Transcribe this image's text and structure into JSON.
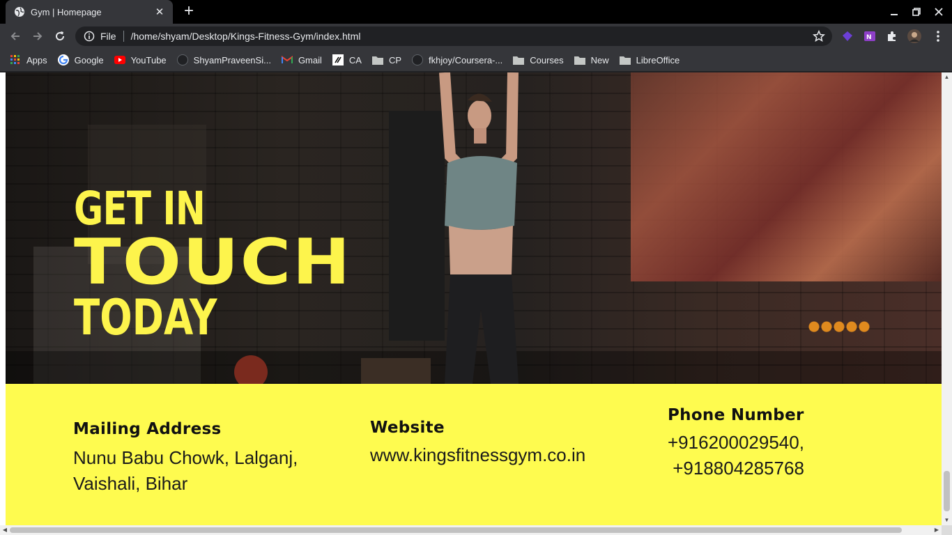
{
  "browser": {
    "tab": {
      "title": "Gym | Homepage",
      "close_glyph": "✕",
      "icon": "globe-icon"
    },
    "new_tab_glyph": "+",
    "window_controls": {
      "minimize": "—",
      "maximize": "❐",
      "close": "✕"
    },
    "address_bar": {
      "scheme_label": "File",
      "url": "/home/shyam/Desktop/Kings-Fitness-Gym/index.html"
    },
    "bookmarks": [
      {
        "label": "Apps",
        "icon": "apps-grid-icon"
      },
      {
        "label": "Google",
        "icon": "google-icon"
      },
      {
        "label": "YouTube",
        "icon": "youtube-icon"
      },
      {
        "label": "ShyamPraveenSi...",
        "icon": "github-icon"
      },
      {
        "label": "Gmail",
        "icon": "gmail-icon"
      },
      {
        "label": "CA",
        "icon": "ca-icon"
      },
      {
        "label": "CP",
        "icon": "folder-icon"
      },
      {
        "label": "fkhjoy/Coursera-...",
        "icon": "github-icon"
      },
      {
        "label": "Courses",
        "icon": "folder-icon"
      },
      {
        "label": "New",
        "icon": "folder-icon"
      },
      {
        "label": "LibreOffice",
        "icon": "folder-icon"
      }
    ],
    "colors": {
      "chrome_dark": "#35363a",
      "tab_strip": "#000000",
      "omnibox": "#202124"
    }
  },
  "page": {
    "hero": {
      "line1": "GET IN",
      "line2": "TOUCH",
      "line3": "TODAY"
    },
    "contact": {
      "mailing": {
        "heading": "Mailing Address",
        "line1": "Nunu Babu Chowk, Lalganj,",
        "line2": "Vaishali, Bihar"
      },
      "website": {
        "heading": "Website",
        "value": "www.kingsfitnessgym.co.in"
      },
      "phone": {
        "heading": "Phone Number",
        "line1": "+916200029540,",
        "line2": " +918804285768"
      }
    },
    "colors": {
      "accent_yellow": "#fefb4f",
      "headline_yellow": "#fdf44c"
    }
  }
}
